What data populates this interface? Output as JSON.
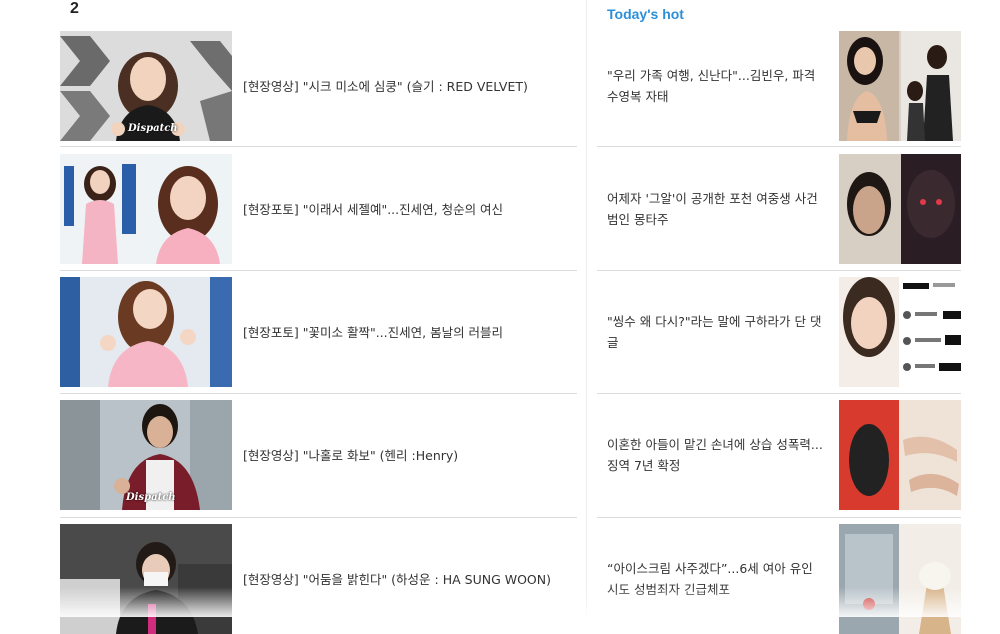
{
  "page_number": "2",
  "hot": {
    "heading": "Today's hot",
    "items": [
      {
        "title": "\"우리 가족 여행, 신난다\"...김빈우, 파격 수영복 자태"
      },
      {
        "title": "어제자 '그알'이 공개한 포천 여중생 사건 범인 몽타주"
      },
      {
        "title": "\"씽수 왜 다시?\"라는 말에 구하라가 단 댓글"
      },
      {
        "title": "이혼한 아들이 맡긴 손녀에 상습 성폭력... 징역 7년 확정"
      },
      {
        "title": "“아이스크림 사주겠다”...6세 여아 유인 시도 성범죄자 긴급체포"
      }
    ]
  },
  "news": {
    "items": [
      {
        "title": "[현장영상] \"시크 미소에 심쿵\" (슬기 : RED VELVET)",
        "logo": "Dispatch"
      },
      {
        "title": "[현장포토] \"이래서 세젤예\"...진세연, 청순의 여신"
      },
      {
        "title": "[현장포토] \"꽃미소 활짝\"...진세연, 봄날의 러블리"
      },
      {
        "title": "[현장영상] \"나홀로 화보\" (헨리 :Henry)",
        "logo": "Dispatch"
      },
      {
        "title": "[현장영상] \"어둠을 밝힌다\" (하성운 : HA SUNG WOON)"
      }
    ]
  },
  "colors": {
    "accent": "#2d8fd8",
    "separator": "#dcdcdc"
  }
}
